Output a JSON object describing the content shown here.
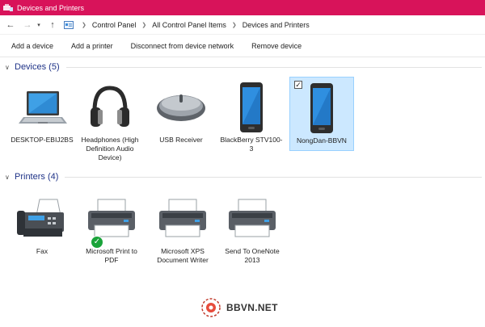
{
  "window": {
    "title": "Devices and Printers",
    "accent_color": "#d8135a"
  },
  "address_bar": {
    "back_icon": "back-arrow-icon",
    "forward_icon": "forward-arrow-icon",
    "recent_icon": "chevron-down-icon",
    "up_icon": "up-arrow-icon",
    "breadcrumbs": [
      "Control Panel",
      "All Control Panel Items",
      "Devices and Printers"
    ]
  },
  "toolbar": {
    "buttons": [
      "Add a device",
      "Add a printer",
      "Disconnect from device network",
      "Remove device"
    ]
  },
  "devices": {
    "header": "Devices (5)",
    "items": [
      {
        "label": "DESKTOP-EBIJ2BS",
        "icon": "laptop-icon"
      },
      {
        "label": "Headphones (High Definition Audio Device)",
        "icon": "headphones-icon"
      },
      {
        "label": "USB Receiver",
        "icon": "mouse-icon"
      },
      {
        "label": "BlackBerry STV100-3",
        "icon": "phone-icon"
      },
      {
        "label": "NongDan-BBVN",
        "icon": "phone-icon",
        "selected": true,
        "checked": true
      }
    ]
  },
  "printers": {
    "header": "Printers (4)",
    "items": [
      {
        "label": "Fax",
        "icon": "fax-icon"
      },
      {
        "label": "Microsoft Print to PDF",
        "icon": "printer-icon",
        "default": true
      },
      {
        "label": "Microsoft XPS Document Writer",
        "icon": "printer-icon"
      },
      {
        "label": "Send To OneNote 2013",
        "icon": "printer-icon"
      }
    ]
  },
  "watermark": {
    "text": "BBVN.NET"
  }
}
